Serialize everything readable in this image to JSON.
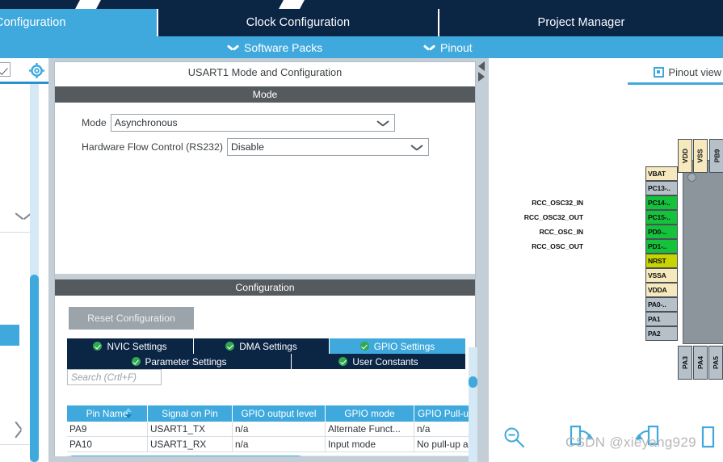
{
  "window": {
    "main_tabs": [
      {
        "label": "Configuration",
        "state": "active"
      },
      {
        "label": "Clock Configuration",
        "state": "inactive"
      },
      {
        "label": "Project Manager",
        "state": "inactive"
      }
    ],
    "sub_tabs": [
      {
        "label": "Software Packs",
        "icon": "chevron-down-icon"
      },
      {
        "label": "Pinout",
        "icon": "chevron-down-icon"
      }
    ]
  },
  "colors": {
    "accent_cyan": "#3fa9dd",
    "tab_navy": "#0b2545",
    "section_header_grey": "#555a5e",
    "panel_border": "#b3bec6",
    "ok_green": "#2fa84f",
    "pin_green": "#14c23c",
    "pin_olive": "#c8d400",
    "pin_cream": "#f5e9bd",
    "pin_grey": "#b6c0c9",
    "chip_body": "#8c949c"
  },
  "peripheral": {
    "panel_title": "USART1 Mode and Configuration",
    "mode_section": {
      "header": "Mode",
      "fields": [
        {
          "label": "Mode",
          "value": "Asynchronous"
        },
        {
          "label": "Hardware Flow Control (RS232)",
          "value": "Disable"
        }
      ]
    },
    "configuration_section": {
      "header": "Configuration",
      "reset_button": "Reset Configuration",
      "tabs_row1": [
        {
          "label": "NVIC Settings",
          "selected": false,
          "status": "ok"
        },
        {
          "label": "DMA Settings",
          "selected": false,
          "status": "ok"
        },
        {
          "label": "GPIO Settings",
          "selected": true,
          "status": "ok"
        }
      ],
      "tabs_row2": [
        {
          "label": "Parameter Settings",
          "selected": false,
          "status": "ok"
        },
        {
          "label": "User Constants",
          "selected": false,
          "status": "ok"
        }
      ],
      "search_placeholder": "Search (Crtl+F)",
      "table": {
        "columns": [
          "Pin Name",
          "Signal on Pin",
          "GPIO output level",
          "GPIO mode",
          "GPIO Pull-u"
        ],
        "sorted_column": "Pin Name",
        "rows": [
          {
            "pin_name": "PA9",
            "signal_on_pin": "USART1_TX",
            "gpio_output_level": "n/a",
            "gpio_mode": "Alternate Funct...",
            "gpio_pull": "n/a"
          },
          {
            "pin_name": "PA10",
            "signal_on_pin": "USART1_RX",
            "gpio_output_level": "n/a",
            "gpio_mode": "Input mode",
            "gpio_pull": "No pull-up a"
          }
        ]
      }
    }
  },
  "pinout": {
    "view_tab_label": "Pinout view",
    "view_tab_icon": "chip-icon",
    "top_pins": [
      {
        "label": "VDD",
        "type": "power"
      },
      {
        "label": "VSS",
        "type": "power"
      },
      {
        "label": "PB9",
        "type": "io"
      }
    ],
    "left_pins": [
      {
        "label": "VBAT",
        "type": "power",
        "signal": ""
      },
      {
        "label": "PC13-..",
        "type": "io",
        "signal": ""
      },
      {
        "label": "PC14-..",
        "type": "assigned",
        "signal": "RCC_OSC32_IN"
      },
      {
        "label": "PC15-..",
        "type": "assigned",
        "signal": "RCC_OSC32_OUT"
      },
      {
        "label": "PD0-..",
        "type": "assigned",
        "signal": "RCC_OSC_IN"
      },
      {
        "label": "PD1-..",
        "type": "assigned",
        "signal": "RCC_OSC_OUT"
      },
      {
        "label": "NRST",
        "type": "reset",
        "signal": ""
      },
      {
        "label": "VSSA",
        "type": "power",
        "signal": ""
      },
      {
        "label": "VDDA",
        "type": "power",
        "signal": ""
      },
      {
        "label": "PA0-..",
        "type": "io",
        "signal": ""
      },
      {
        "label": "PA1",
        "type": "io",
        "signal": ""
      },
      {
        "label": "PA2",
        "type": "io",
        "signal": ""
      }
    ],
    "bottom_pins": [
      {
        "label": "PA3",
        "type": "io"
      },
      {
        "label": "PA4",
        "type": "io"
      },
      {
        "label": "PA5",
        "type": "io"
      }
    ],
    "toolbar": [
      {
        "icon": "zoom-out-icon",
        "label": ""
      },
      {
        "icon": "rotate-right-icon",
        "label": ""
      },
      {
        "icon": "rotate-left-icon",
        "label": ""
      },
      {
        "icon": "fit-icon",
        "label": ""
      }
    ]
  },
  "watermark": {
    "text": "CSDN @xieyang929"
  }
}
